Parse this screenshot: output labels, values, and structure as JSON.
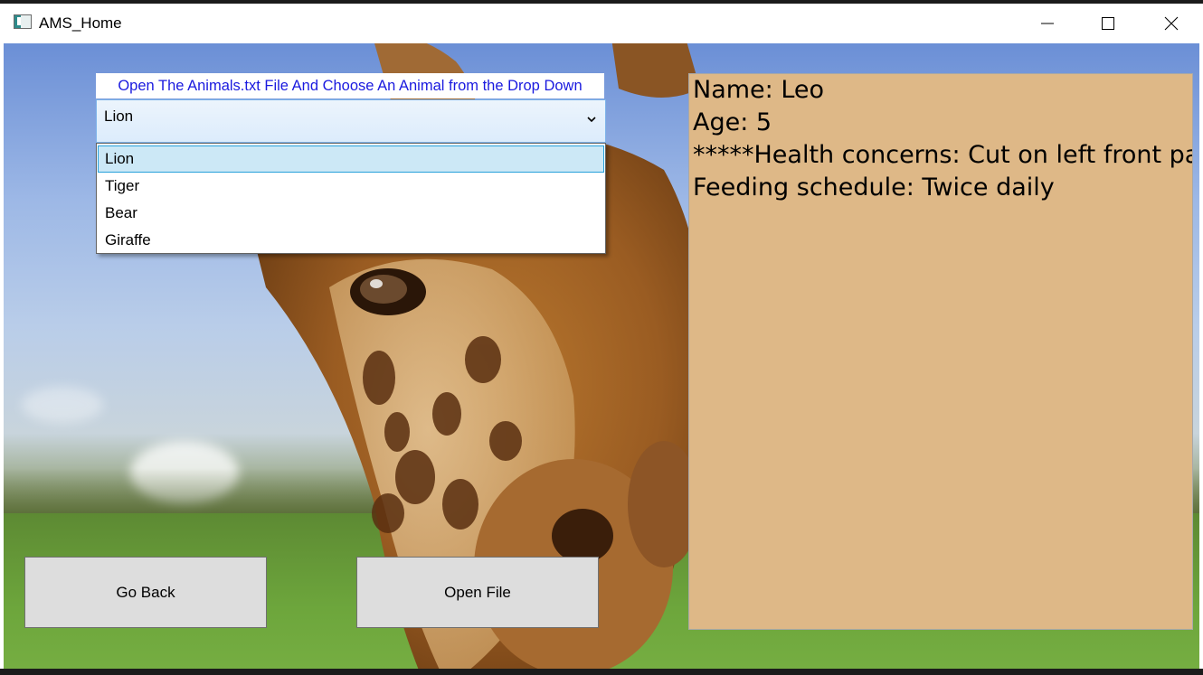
{
  "window": {
    "title": "AMS_Home",
    "controls": {
      "minimize": "minimize",
      "maximize": "maximize",
      "close": "close"
    }
  },
  "form": {
    "instruction": "Open The Animals.txt File And Choose An Animal from the Drop Down",
    "combo": {
      "selected": "Lion",
      "options": [
        "Lion",
        "Tiger",
        "Bear",
        "Giraffe"
      ],
      "highlighted_index": 0,
      "expanded": true
    },
    "details": {
      "lines": [
        "Name: Leo",
        "Age: 5",
        "*****Health concerns: Cut on left front paw",
        "Feeding schedule: Twice daily"
      ]
    },
    "buttons": {
      "back": "Go Back",
      "open": "Open File"
    }
  },
  "colors": {
    "details_bg": "#deb887",
    "instruction_text": "#1a1adf",
    "selection_bg": "#cce8f6",
    "selection_border": "#26a0da",
    "button_bg": "#dddddd"
  },
  "icons": {
    "app": "app-window-icon",
    "dropdown": "chevron-down-icon",
    "minimize": "minimize-icon",
    "maximize": "maximize-icon",
    "close": "close-icon"
  }
}
